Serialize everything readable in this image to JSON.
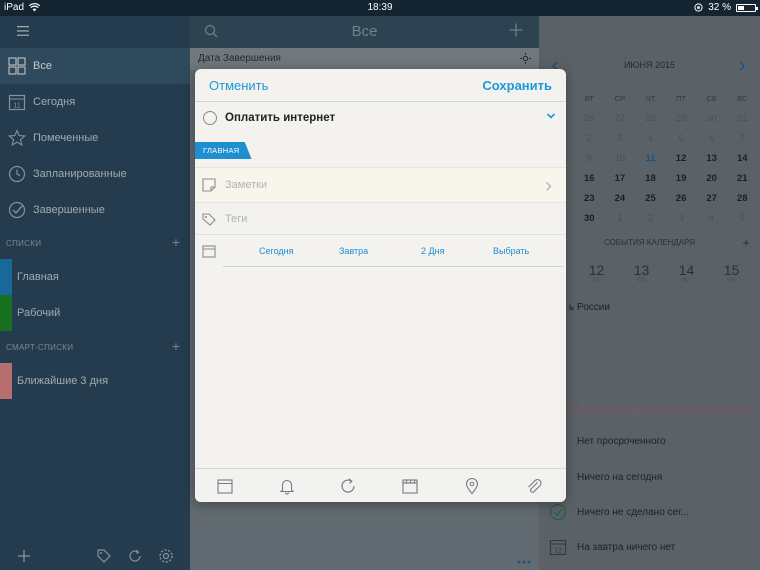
{
  "status_bar": {
    "device": "iPad",
    "time": "18:39",
    "battery": "32 %",
    "battery_level": 0.32
  },
  "sidebar": {
    "items": [
      {
        "label": "Все",
        "icon": "grid-icon"
      },
      {
        "label": "Сегодня",
        "icon": "calendar-11-icon",
        "badge": "11"
      },
      {
        "label": "Помеченные",
        "icon": "star-icon"
      },
      {
        "label": "Запланированные",
        "icon": "clock-icon"
      },
      {
        "label": "Завершенные",
        "icon": "check-circle-icon"
      }
    ],
    "lists_header": "СПИСКИ",
    "lists": [
      {
        "label": "Главная",
        "color": "#1f86c8"
      },
      {
        "label": "Рабочий",
        "color": "#1f8f2a"
      }
    ],
    "smart_header": "СМАРТ-СПИСКИ",
    "smart_lists": [
      {
        "label": "Ближайшие 3 дня",
        "color": "#e98e8e"
      }
    ]
  },
  "middle": {
    "title": "Все",
    "sort_label": "Дата Завершения"
  },
  "calendar": {
    "month": "ИЮНЯ 2015",
    "weekdays": [
      "ВТ",
      "СР",
      "ЧТ",
      "ПТ",
      "СБ",
      "ВС"
    ],
    "weeks": [
      [
        "26",
        "27",
        "28",
        "29",
        "30",
        "31"
      ],
      [
        "2",
        "3",
        "4",
        "5",
        "6",
        "7"
      ],
      [
        "9",
        "10",
        "11",
        "12",
        "13",
        "14"
      ],
      [
        "16",
        "17",
        "18",
        "19",
        "20",
        "21"
      ],
      [
        "23",
        "24",
        "25",
        "26",
        "27",
        "28"
      ],
      [
        "30",
        "1",
        "2",
        "3",
        "4",
        "5"
      ]
    ],
    "today": "11",
    "events_header": "СОБЫТИЯ КАЛЕНДАРЯ",
    "week_days": [
      {
        "num": "12",
        "dow": "ПТ"
      },
      {
        "num": "13",
        "dow": "СБ"
      },
      {
        "num": "14",
        "dow": "ВС"
      },
      {
        "num": "15",
        "dow": "ПН"
      }
    ],
    "holiday": "ь России",
    "summaries": [
      {
        "label": "Нет просроченного",
        "icon": "overdue-icon"
      },
      {
        "label": "Ничего на сегодня",
        "icon": "today-icon"
      },
      {
        "label": "Ничего не сделано сег...",
        "icon": "done-today-icon"
      },
      {
        "label": "На завтра ничего нет",
        "icon": "tomorrow-12-icon",
        "badge": "12"
      }
    ]
  },
  "modal": {
    "cancel_label": "Отменить",
    "save_label": "Сохранить",
    "task_title": "Оплатить интернет",
    "list_tag": "ГЛАВНАЯ",
    "notes_placeholder": "Заметки",
    "tags_placeholder": "Теги",
    "date_options": [
      "Сегодня",
      "Завтра",
      "2 Дня",
      "Выбрать"
    ],
    "toolbar": [
      "calendar-icon",
      "bell-icon",
      "repeat-icon",
      "clapper-icon",
      "location-pin-icon",
      "paperclip-icon"
    ]
  },
  "colors": {
    "accent": "#1a9ad8",
    "sidebar": "#2f4e63",
    "modal_bg": "#f3f2ef"
  }
}
